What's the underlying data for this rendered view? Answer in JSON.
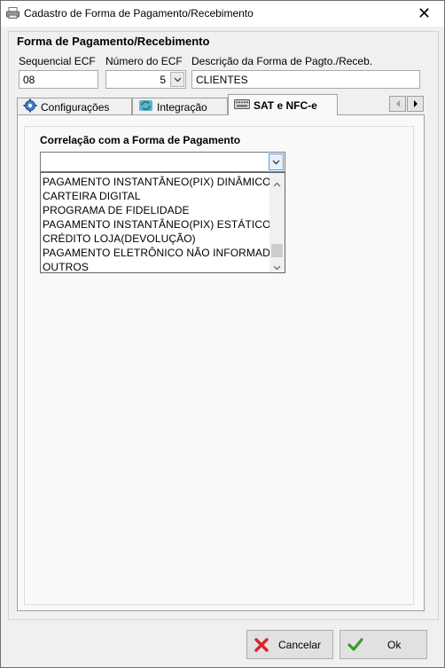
{
  "window": {
    "title": "Cadastro de Forma de Pagamento/Recebimento",
    "icon": "app-printer-icon",
    "close_glyph": "✕"
  },
  "form": {
    "section_title": "Forma de Pagamento/Recebimento",
    "sequencial_label": "Sequencial ECF",
    "sequencial_value": "08",
    "numero_label": "Número do ECF",
    "numero_value": "5",
    "descricao_label": "Descrição da Forma de Pagto./Receb.",
    "descricao_value": "CLIENTES"
  },
  "tabs": [
    {
      "label": "Configurações",
      "icon": "gear-icon",
      "active": false
    },
    {
      "label": "Integração",
      "icon": "sync-icon",
      "active": false
    },
    {
      "label": "SAT e NFC-e",
      "icon": "keyboard-icon",
      "active": true
    }
  ],
  "sat": {
    "correlacao_label": "Correlação com a Forma de Pagamento",
    "combo_value": "",
    "options": [
      "PAGAMENTO INSTANTÂNEO(PIX) DINÂMICO",
      "CARTEIRA DIGITAL",
      "PROGRAMA DE FIDELIDADE",
      "PAGAMENTO INSTANTÂNEO(PIX) ESTÁTICO",
      "CRÉDITO LOJA(DEVOLUÇÃO)",
      "PAGAMENTO ELETRÔNICO NÃO INFORMADO",
      "OUTROS"
    ]
  },
  "buttons": {
    "cancel_label": "Cancelar",
    "ok_label": "Ok"
  },
  "colors": {
    "cancel_icon": "#d9232e",
    "ok_icon": "#3a9a2e",
    "combo_button_border": "#569de5"
  }
}
